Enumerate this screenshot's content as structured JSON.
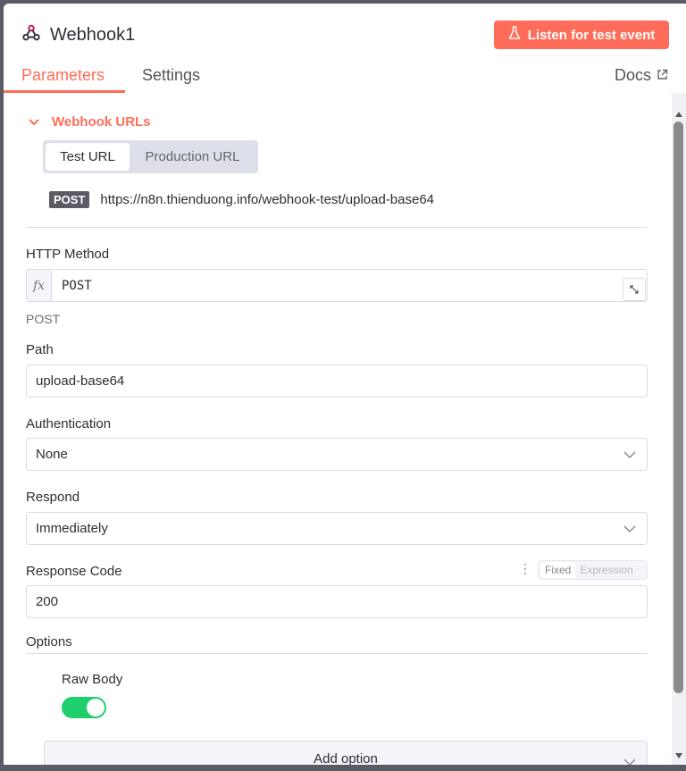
{
  "node": {
    "title": "Webhook1",
    "listen_label": "Listen for test event"
  },
  "tabs": [
    {
      "label": "Parameters",
      "active": true
    },
    {
      "label": "Settings",
      "active": false
    }
  ],
  "docs_label": "Docs",
  "webhook_urls": {
    "section_label": "Webhook URLs",
    "test_label": "Test URL",
    "production_label": "Production URL",
    "method_badge": "POST",
    "url": "https://n8n.thienduong.info/webhook-test/upload-base64"
  },
  "fields": {
    "http_method": {
      "label": "HTTP Method",
      "fx": "fx",
      "value": "POST",
      "hint": "POST"
    },
    "path": {
      "label": "Path",
      "value": "upload-base64"
    },
    "authentication": {
      "label": "Authentication",
      "value": "None"
    },
    "respond": {
      "label": "Respond",
      "value": "Immediately"
    },
    "response_code": {
      "label": "Response Code",
      "value": "200",
      "mode_fixed": "Fixed",
      "mode_expression": "Expression"
    }
  },
  "options": {
    "label": "Options",
    "raw_body_label": "Raw Body",
    "raw_body_on": true,
    "add_option_label": "Add option"
  },
  "colors": {
    "accent": "#ff6d5a",
    "toggle_on": "#1fce6d"
  }
}
